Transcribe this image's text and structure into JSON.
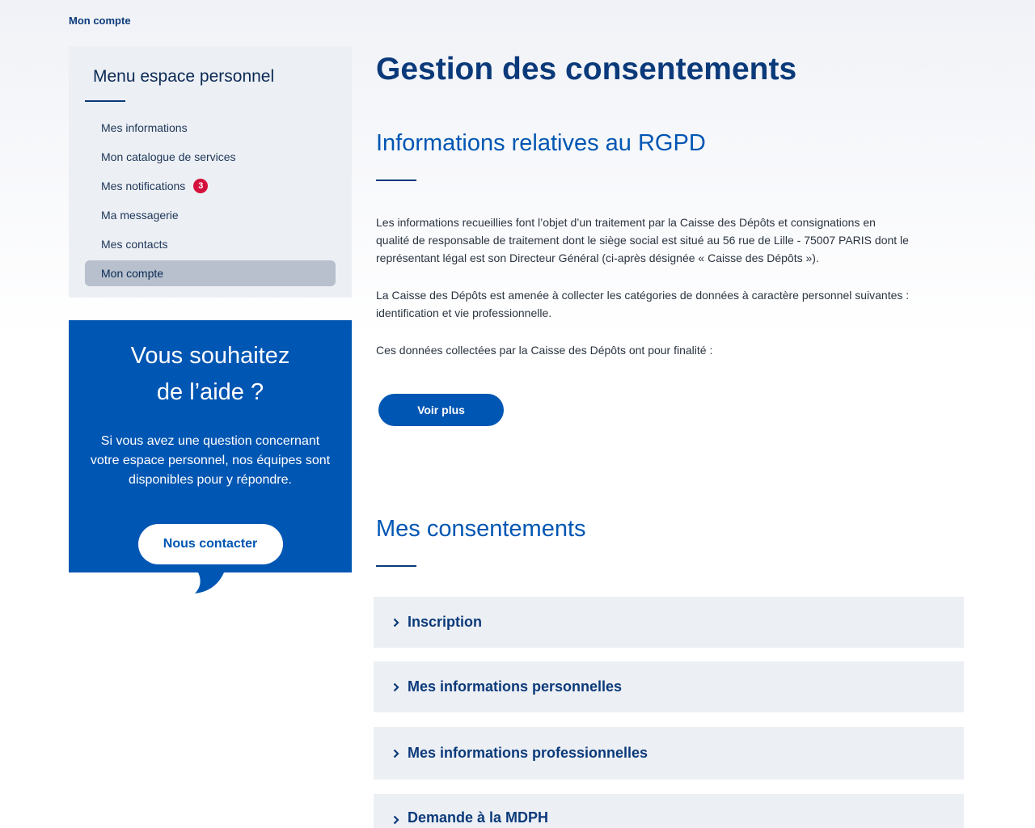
{
  "breadcrumb": {
    "current": "Mon compte"
  },
  "sidebar": {
    "title": "Menu espace personnel",
    "items": [
      {
        "label": "Mes informations"
      },
      {
        "label": "Mon catalogue de services"
      },
      {
        "label": "Mes notifications",
        "badge": "3"
      },
      {
        "label": "Ma messagerie"
      },
      {
        "label": "Mes contacts"
      },
      {
        "label": "Mon compte",
        "active": true
      }
    ]
  },
  "help": {
    "title_line1": "Vous souhaitez",
    "title_line2": "de l’aide ?",
    "text": "Si vous avez une question concernant votre espace personnel, nos équipes sont disponibles pour y répondre.",
    "button_label": "Nous contacter"
  },
  "main": {
    "title": "Gestion des consentements",
    "rgpd": {
      "title": "Informations relatives au RGPD",
      "paragraphs": [
        "Les informations recueillies font l’objet d’un traitement par la Caisse des Dépôts et consignations en qualité de responsable de traitement dont le siège social est situé au 56 rue de Lille - 75007 PARIS dont le représentant légal est son Directeur Général (ci-après désignée « Caisse des Dépôts »).",
        "La Caisse des Dépôts est amenée à collecter les catégories de données à caractère personnel suivantes : identification et vie professionnelle.",
        "Ces données collectées par la Caisse des Dépôts ont pour finalité :"
      ],
      "button_label": "Voir plus"
    },
    "consents": {
      "title": "Mes consentements",
      "accordions": [
        {
          "label": "Inscription"
        },
        {
          "label": "Mes informations personnelles"
        },
        {
          "label": "Mes informations professionnelles"
        },
        {
          "label": "Demande à la MDPH"
        }
      ]
    }
  },
  "icons": {
    "accordion": "chevron-right-icon",
    "help_tail": "speech-bubble-tail-icon"
  },
  "colors": {
    "primary": "#0056b3",
    "dark_blue": "#0b3a7a",
    "badge_red": "#d4103c",
    "panel_bg": "#eceff4"
  }
}
